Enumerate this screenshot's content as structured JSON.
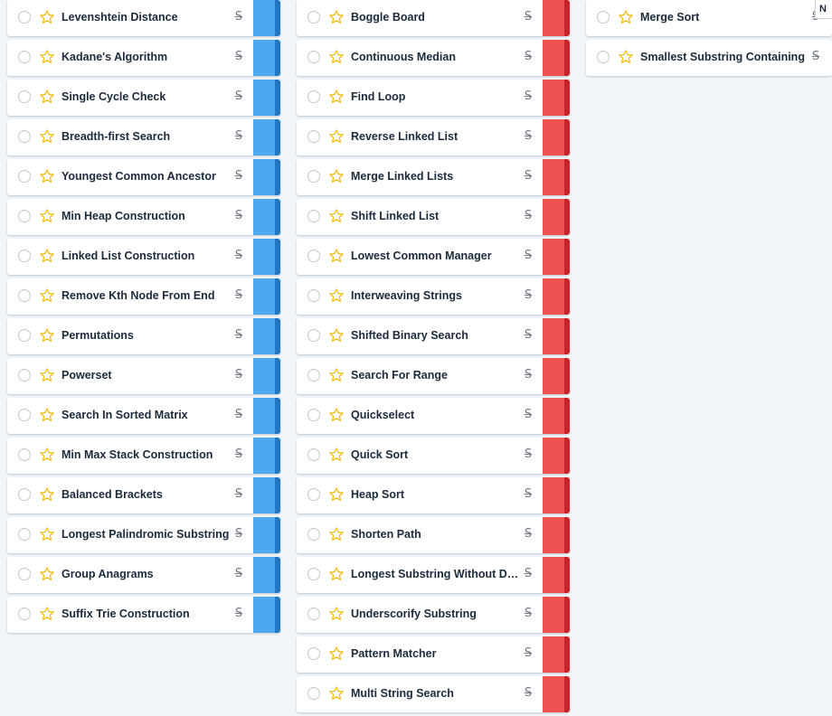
{
  "colors": {
    "page_background": "#f2f6f9",
    "star": "#f5b800",
    "blue_strip": "#4ea8ef",
    "blue_strip_edge": "#2277c2",
    "red_strip": "#f05252",
    "red_strip_edge": "#c4242b"
  },
  "icons": {
    "checkbox": "circle-checkbox-icon",
    "favorite": "star-outline-icon",
    "strikethrough": "strikethrough-s-icon"
  },
  "corner_tab": {
    "label": "N"
  },
  "columns": [
    {
      "strip_color": "blue",
      "questions": [
        {
          "name": "Levenshtein Distance"
        },
        {
          "name": "Kadane's Algorithm"
        },
        {
          "name": "Single Cycle Check"
        },
        {
          "name": "Breadth-first Search"
        },
        {
          "name": "Youngest Common Ancestor"
        },
        {
          "name": "Min Heap Construction"
        },
        {
          "name": "Linked List Construction"
        },
        {
          "name": "Remove Kth Node From End"
        },
        {
          "name": "Permutations"
        },
        {
          "name": "Powerset"
        },
        {
          "name": "Search In Sorted Matrix"
        },
        {
          "name": "Min Max Stack Construction"
        },
        {
          "name": "Balanced Brackets"
        },
        {
          "name": "Longest Palindromic Substring"
        },
        {
          "name": "Group Anagrams"
        },
        {
          "name": "Suffix Trie Construction"
        }
      ]
    },
    {
      "strip_color": "red",
      "questions": [
        {
          "name": "Boggle Board"
        },
        {
          "name": "Continuous Median"
        },
        {
          "name": "Find Loop"
        },
        {
          "name": "Reverse Linked List"
        },
        {
          "name": "Merge Linked Lists"
        },
        {
          "name": "Shift Linked List"
        },
        {
          "name": "Lowest Common Manager"
        },
        {
          "name": "Interweaving Strings"
        },
        {
          "name": "Shifted Binary Search"
        },
        {
          "name": "Search For Range"
        },
        {
          "name": "Quickselect"
        },
        {
          "name": "Quick Sort"
        },
        {
          "name": "Heap Sort"
        },
        {
          "name": "Shorten Path"
        },
        {
          "name": "Longest Substring Without Du..."
        },
        {
          "name": "Underscorify Substring"
        },
        {
          "name": "Pattern Matcher"
        },
        {
          "name": "Multi String Search"
        }
      ]
    },
    {
      "strip_color": "none",
      "questions": [
        {
          "name": "Merge Sort"
        },
        {
          "name": "Smallest Substring Containing"
        }
      ]
    }
  ]
}
